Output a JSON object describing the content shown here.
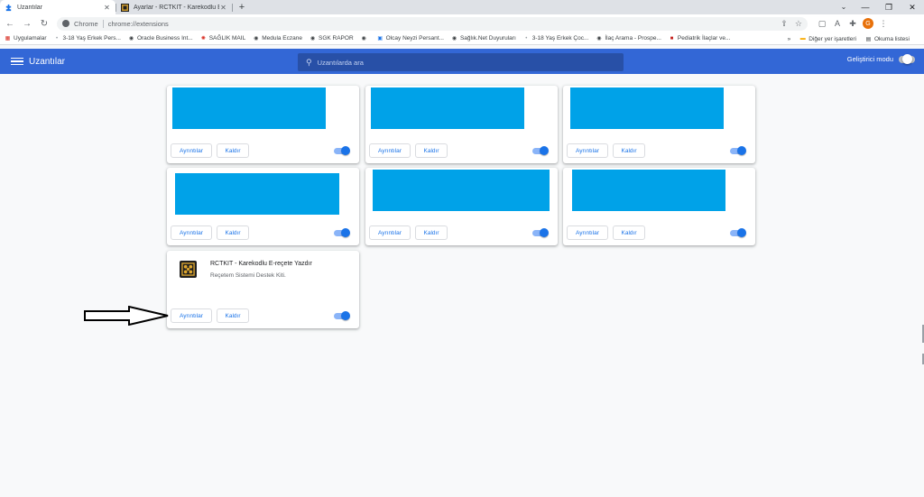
{
  "tabs": [
    {
      "title": "Uzantılar",
      "active": true,
      "icon": "puzzle-icon"
    },
    {
      "title": "Ayarlar - RCTKIT - Karekodlu E-reçete Yazdır",
      "active": false,
      "icon": "rctkit-favicon"
    }
  ],
  "omnibox": {
    "chip": "Chrome",
    "url": "chrome://extensions"
  },
  "bookmarks": {
    "items": [
      {
        "label": "Uygulamalar",
        "icon": "apps-grid-icon"
      },
      {
        "label": "3-18 Yaş Erkek Pers...",
        "icon": "dot-icon"
      },
      {
        "label": "Oracle Business Int...",
        "icon": "globe-icon"
      },
      {
        "label": "SAĞLIK MAIL",
        "icon": "mail-icon"
      },
      {
        "label": "Medula Eczane",
        "icon": "globe-icon"
      },
      {
        "label": "SGK RAPOR",
        "icon": "globe-icon"
      },
      {
        "label": "",
        "icon": "globe-icon"
      },
      {
        "label": "Olcay Neyzi Persant...",
        "icon": "image-icon"
      },
      {
        "label": "Sağlık.Net Duyuruları",
        "icon": "globe-icon"
      },
      {
        "label": "3-18 Yaş Erkek Çoc...",
        "icon": "dot-icon"
      },
      {
        "label": "İlaç Arama - Prospe...",
        "icon": "globe-icon"
      },
      {
        "label": "Pediatrik İlaçlar ve...",
        "icon": "red-square-icon"
      }
    ],
    "more": "»",
    "other": "Diğer yer işaretleri",
    "reading_list": "Okuma listesi"
  },
  "header": {
    "title": "Uzantılar",
    "search_placeholder": "Uzantılarda ara",
    "dev_mode_label": "Geliştirici modu",
    "dev_mode_on": false
  },
  "cards": [
    {
      "details": "Ayrıntılar",
      "remove": "Kaldır",
      "enabled": true
    },
    {
      "details": "Ayrıntılar",
      "remove": "Kaldır",
      "enabled": true
    },
    {
      "details": "Ayrıntılar",
      "remove": "Kaldır",
      "enabled": true
    },
    {
      "details": "Ayrıntılar",
      "remove": "Kaldır",
      "enabled": true
    },
    {
      "details": "Ayrıntılar",
      "remove": "Kaldır",
      "enabled": true
    },
    {
      "details": "Ayrıntılar",
      "remove": "Kaldır",
      "enabled": true
    }
  ],
  "rctkit": {
    "name": "RCTKIT - Karekodlu E-reçete Yazdır",
    "description": "Reçetem Sistemi Destek Kiti.",
    "details": "Ayrıntılar",
    "remove": "Kaldır",
    "enabled": true
  },
  "colors": {
    "header": "#3367d6",
    "redaction": "#00a2e8",
    "accent": "#1a73e8"
  }
}
